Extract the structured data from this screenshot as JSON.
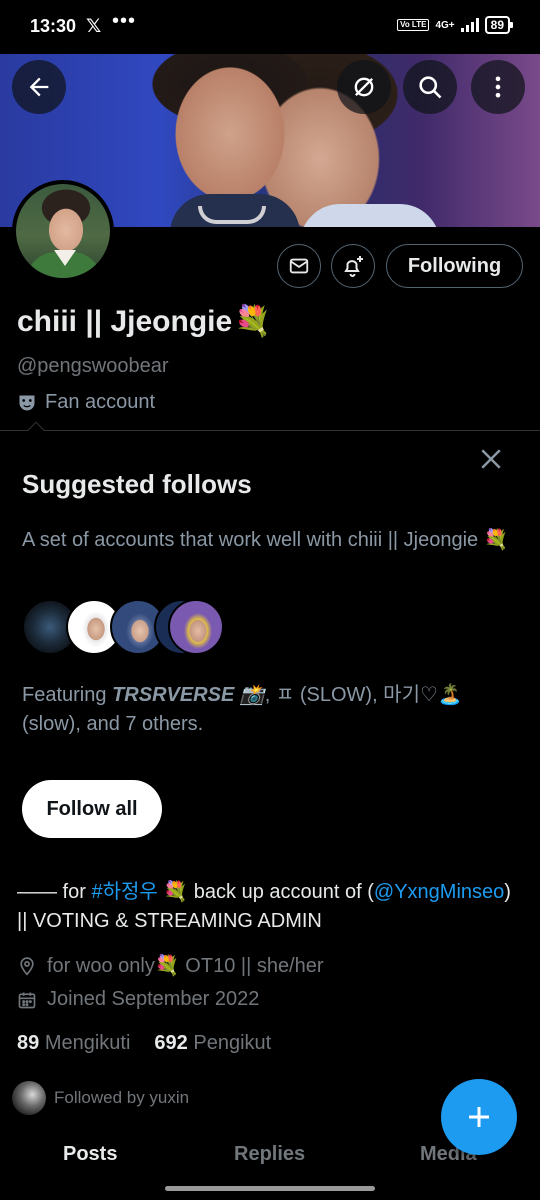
{
  "status_bar": {
    "time": "13:30",
    "x_glyph": "𝕏",
    "overflow": "•••",
    "volte": "Vo LTE",
    "network": "4G+",
    "battery": "89"
  },
  "header": {
    "back_icon": "arrow-left-icon",
    "translate_icon": "no-translate-icon",
    "search_icon": "search-icon",
    "more_icon": "more-vertical-icon"
  },
  "profile": {
    "name": "chiii || Jjeongie",
    "name_emoji": "💐",
    "handle": "@pengswoobear",
    "category": "Fan account",
    "follow_state": "Following"
  },
  "suggested": {
    "title": "Suggested follows",
    "description": "A set of accounts that work well with chiii || Jjeongie 💐",
    "featuring_prefix": "Featuring ",
    "featuring_bold": "TRSRVERSE 📸",
    "featuring_rest": ", ㅍ (SLOW), 마기♡🏝️ (slow), and 7 others.",
    "follow_all": "Follow all"
  },
  "bio": {
    "part1": "—— for ",
    "hashtag": "#하정우",
    "part2": " 💐 back up account of (",
    "mention": "@YxngMinseo",
    "part3": ") || VOTING & STREAMING ADMIN"
  },
  "meta": {
    "location": "for woo only💐 OT10 || she/her",
    "joined": "Joined September 2022"
  },
  "counts": {
    "following_num": "89",
    "following_label": "Mengikuti",
    "followers_num": "692",
    "followers_label": "Pengikut"
  },
  "followed_by": "Followed by yuxin",
  "tabs": [
    {
      "label": "Posts"
    },
    {
      "label": "Replies"
    },
    {
      "label": "Media"
    }
  ],
  "colors": {
    "accent": "#1d9bf0",
    "background": "#000000",
    "text_primary": "#e7e9ea",
    "text_secondary": "#71767b"
  }
}
